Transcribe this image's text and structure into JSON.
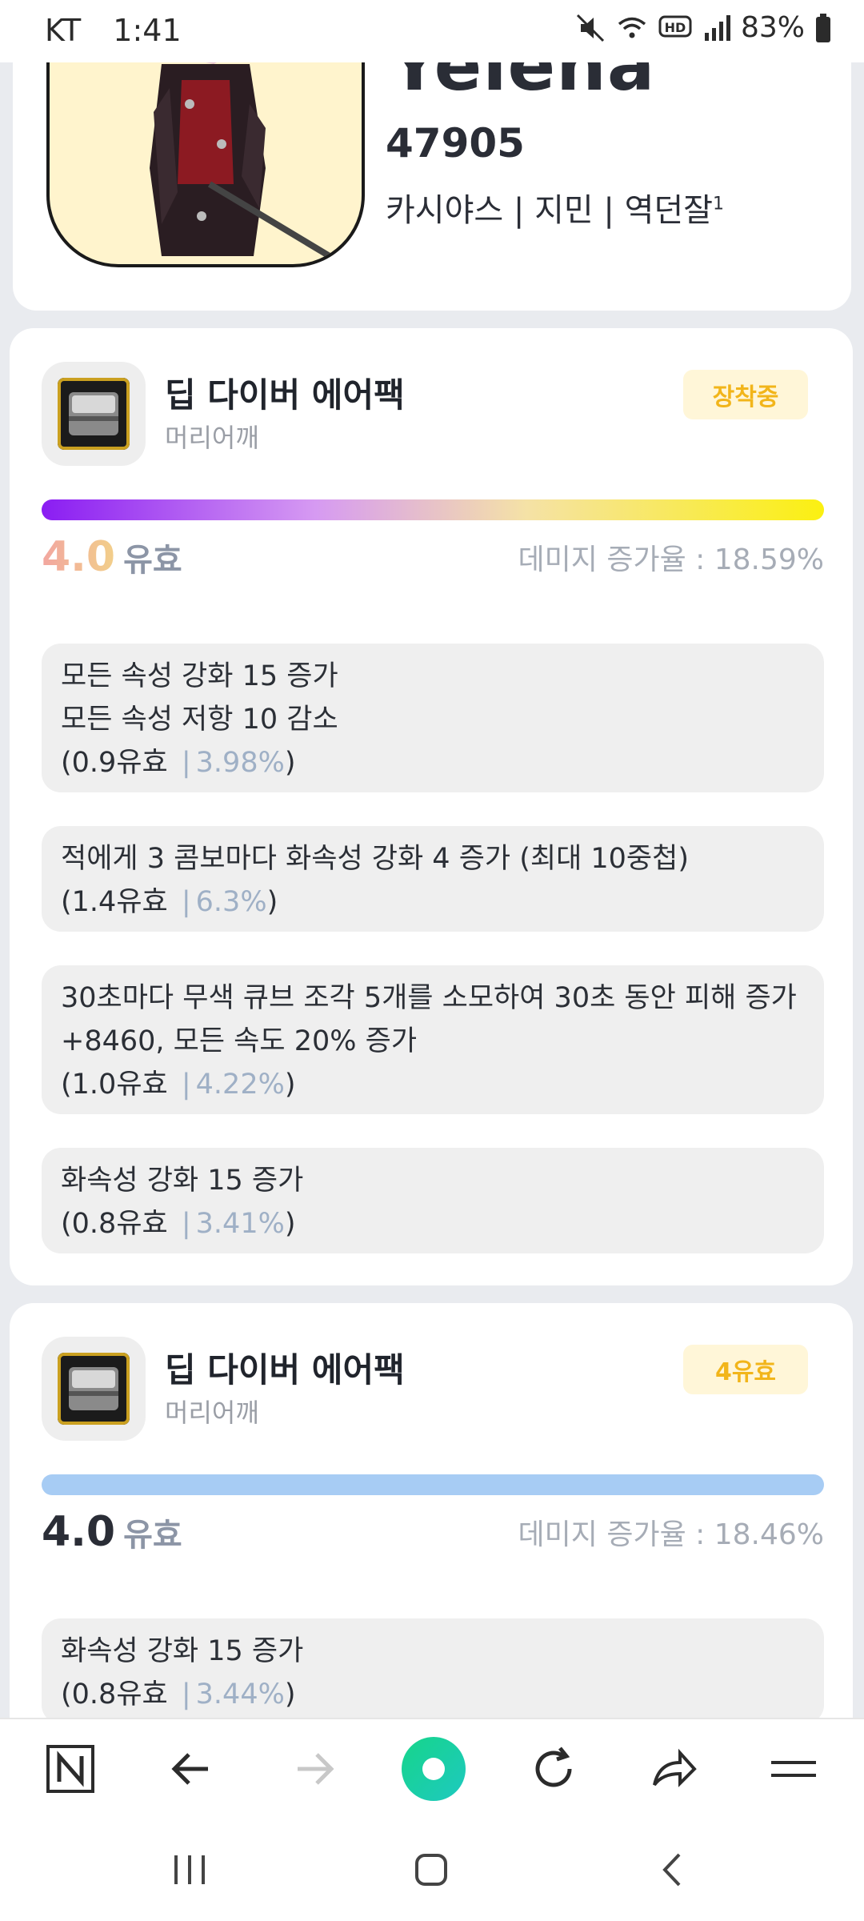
{
  "status_bar": {
    "carrier": "KT",
    "time": "1:41",
    "battery": "83%",
    "icons": [
      "mute-icon",
      "wifi-icon",
      "hd-voice-icon",
      "signal-icon",
      "battery-icon"
    ]
  },
  "profile": {
    "name": "Yelena",
    "number": "47905",
    "info": "카시야스 | 지민 | 역던잘",
    "info_sup": "1"
  },
  "items": [
    {
      "name": "딥 다이버 에어팩",
      "slot": "머리어깨",
      "badge": "장착중",
      "score": "4.0",
      "score_unit": "유효",
      "damage": "데미지 증가율 : 18.59%",
      "options": [
        {
          "text": "모든 속성 강화 15 증가\n모든 속성 저항 10 감소",
          "value": "(0.9유효",
          "sep": "|",
          "pct": "3.98%",
          "close": ")"
        },
        {
          "text": "적에게 3 콤보마다 화속성 강화 4 증가 (최대 10중첩)",
          "value": "(1.4유효",
          "sep": "|",
          "pct": "6.3%",
          "close": ")"
        },
        {
          "text": "30초마다 무색 큐브 조각 5개를 소모하여 30초 동안 피해 증가\n+8460, 모든 속도 20% 증가",
          "value": "(1.0유효",
          "sep": "|",
          "pct": "4.22%",
          "close": ")"
        },
        {
          "text": "화속성 강화 15 증가",
          "value": "(0.8유효",
          "sep": "|",
          "pct": "3.41%",
          "close": ")"
        }
      ]
    },
    {
      "name": "딥 다이버 에어팩",
      "slot": "머리어깨",
      "badge": "4유효",
      "score": "4.0",
      "score_unit": "유효",
      "damage": "데미지 증가율 : 18.46%",
      "options": [
        {
          "text": "화속성 강화 15 증가",
          "value": "(0.8유효",
          "sep": "|",
          "pct": "3.44%",
          "close": ")"
        }
      ]
    }
  ],
  "browser_bar": {
    "buttons": [
      "naver-home-icon",
      "back-icon",
      "forward-icon",
      "green-dot-icon",
      "refresh-icon",
      "share-icon",
      "menu-icon"
    ]
  },
  "system_nav": {
    "buttons": [
      "recent-apps-icon",
      "home-icon",
      "back-nav-icon"
    ]
  },
  "colors": {
    "badge_text": "#f2b51a",
    "badge_bg": "#fff6d8",
    "bar_blue": "#a7ccf4",
    "pct_text": "#9fb0c6"
  }
}
